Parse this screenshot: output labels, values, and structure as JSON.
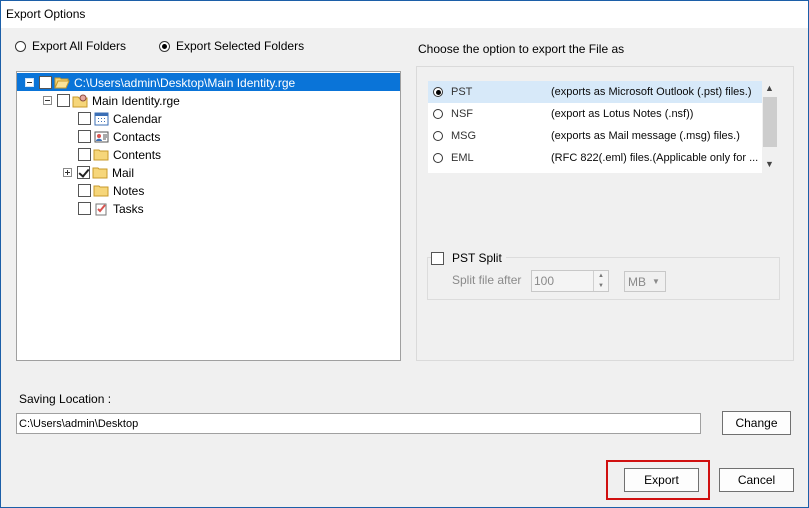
{
  "window": {
    "title": "Export Options"
  },
  "scope": {
    "all_label": "Export All Folders",
    "selected_label": "Export Selected Folders",
    "selected": "selected"
  },
  "tree": {
    "root_path": "C:\\Users\\admin\\Desktop\\Main Identity.rge",
    "identity": "Main Identity.rge",
    "folders": [
      {
        "label": "Calendar",
        "checked": false,
        "icon": "calendar-icon"
      },
      {
        "label": "Contacts",
        "checked": false,
        "icon": "contacts-icon"
      },
      {
        "label": "Contents",
        "checked": false,
        "icon": "folder-icon"
      },
      {
        "label": "Mail",
        "checked": true,
        "icon": "folder-icon",
        "expandable": true
      },
      {
        "label": "Notes",
        "checked": false,
        "icon": "notes-icon"
      },
      {
        "label": "Tasks",
        "checked": false,
        "icon": "tasks-icon"
      }
    ]
  },
  "formats": {
    "heading": "Choose the option to export the File as",
    "options": [
      {
        "name": "PST",
        "desc": "(exports as Microsoft Outlook (.pst) files.)",
        "selected": true
      },
      {
        "name": "NSF",
        "desc": "(export as Lotus Notes (.nsf))",
        "selected": false
      },
      {
        "name": "MSG",
        "desc": "(exports as Mail message (.msg) files.)",
        "selected": false
      },
      {
        "name": "EML",
        "desc": "(RFC 822(.eml) files.(Applicable only for ...",
        "selected": false
      }
    ]
  },
  "pst_split": {
    "label": "PST Split",
    "after_label": "Split file after",
    "value": "100",
    "unit": "MB",
    "checked": false
  },
  "saving": {
    "label": "Saving Location :",
    "path": "C:\\Users\\admin\\Desktop",
    "change_label": "Change"
  },
  "actions": {
    "export_label": "Export",
    "cancel_label": "Cancel"
  },
  "colors": {
    "selection": "#0a74d8",
    "highlight": "#d01010",
    "list_selection": "#d7e9f9"
  }
}
